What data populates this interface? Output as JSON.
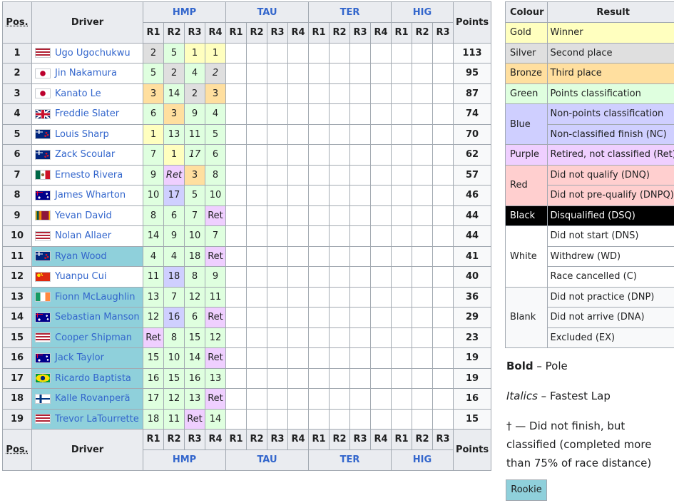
{
  "headers": {
    "pos": "Pos.",
    "driver": "Driver",
    "points": "Points"
  },
  "events": [
    {
      "name": "HMP",
      "rounds": [
        "R1",
        "R2",
        "R3",
        "R4"
      ]
    },
    {
      "name": "TAU",
      "rounds": [
        "R1",
        "R2",
        "R3",
        "R4"
      ]
    },
    {
      "name": "TER",
      "rounds": [
        "R1",
        "R2",
        "R3",
        "R4"
      ]
    },
    {
      "name": "HIG",
      "rounds": [
        "R1",
        "R2",
        "R3"
      ]
    }
  ],
  "rows": [
    {
      "pos": "1",
      "driver": "Ugo Ugochukwu",
      "flag": "us",
      "rookie": false,
      "points": "113",
      "results": [
        {
          "v": "2",
          "c": "silver",
          "b": true
        },
        {
          "v": "5",
          "c": "green"
        },
        {
          "v": "1",
          "c": "gold"
        },
        {
          "v": "1",
          "c": "gold",
          "b": true
        }
      ]
    },
    {
      "pos": "2",
      "driver": "Jin Nakamura",
      "flag": "jp",
      "rookie": false,
      "points": "95",
      "results": [
        {
          "v": "5",
          "c": "green"
        },
        {
          "v": "2",
          "c": "silver"
        },
        {
          "v": "4",
          "c": "green"
        },
        {
          "v": "2",
          "c": "silver",
          "i": true
        }
      ]
    },
    {
      "pos": "3",
      "driver": "Kanato Le",
      "flag": "jp",
      "rookie": false,
      "points": "87",
      "results": [
        {
          "v": "3",
          "c": "bronze"
        },
        {
          "v": "14",
          "c": "green"
        },
        {
          "v": "2",
          "c": "silver"
        },
        {
          "v": "3",
          "c": "bronze"
        }
      ]
    },
    {
      "pos": "4",
      "driver": "Freddie Slater",
      "flag": "gb",
      "rookie": false,
      "points": "74",
      "results": [
        {
          "v": "6",
          "c": "green"
        },
        {
          "v": "3",
          "c": "bronze"
        },
        {
          "v": "9",
          "c": "green"
        },
        {
          "v": "4",
          "c": "green"
        }
      ]
    },
    {
      "pos": "5",
      "driver": "Louis Sharp",
      "flag": "nz",
      "rookie": false,
      "points": "70",
      "results": [
        {
          "v": "1",
          "c": "gold"
        },
        {
          "v": "13",
          "c": "green"
        },
        {
          "v": "11",
          "c": "green"
        },
        {
          "v": "5",
          "c": "green"
        }
      ]
    },
    {
      "pos": "6",
      "driver": "Zack Scoular",
      "flag": "nz",
      "rookie": false,
      "points": "62",
      "results": [
        {
          "v": "7",
          "c": "green"
        },
        {
          "v": "1",
          "c": "gold"
        },
        {
          "v": "17",
          "c": "green",
          "i": true
        },
        {
          "v": "6",
          "c": "green"
        }
      ]
    },
    {
      "pos": "7",
      "driver": "Ernesto Rivera",
      "flag": "mx",
      "rookie": false,
      "points": "57",
      "results": [
        {
          "v": "9",
          "c": "green"
        },
        {
          "v": "Ret",
          "c": "purple",
          "i": true
        },
        {
          "v": "3",
          "c": "bronze"
        },
        {
          "v": "8",
          "c": "green"
        }
      ]
    },
    {
      "pos": "8",
      "driver": "James Wharton",
      "flag": "au",
      "rookie": false,
      "points": "46",
      "results": [
        {
          "v": "10",
          "c": "green"
        },
        {
          "v": "17",
          "c": "blue"
        },
        {
          "v": "5",
          "c": "green"
        },
        {
          "v": "10",
          "c": "green"
        }
      ]
    },
    {
      "pos": "9",
      "driver": "Yevan David",
      "flag": "lk",
      "rookie": false,
      "points": "44",
      "results": [
        {
          "v": "8",
          "c": "green"
        },
        {
          "v": "6",
          "c": "green"
        },
        {
          "v": "7",
          "c": "green"
        },
        {
          "v": "Ret",
          "c": "purple"
        }
      ]
    },
    {
      "pos": "10",
      "driver": "Nolan Allaer",
      "flag": "us",
      "rookie": false,
      "points": "44",
      "results": [
        {
          "v": "14",
          "c": "green"
        },
        {
          "v": "9",
          "c": "green"
        },
        {
          "v": "10",
          "c": "green"
        },
        {
          "v": "7",
          "c": "green"
        }
      ]
    },
    {
      "pos": "11",
      "driver": "Ryan Wood",
      "flag": "nz",
      "rookie": true,
      "points": "41",
      "results": [
        {
          "v": "4",
          "c": "green"
        },
        {
          "v": "4",
          "c": "green"
        },
        {
          "v": "18",
          "c": "green"
        },
        {
          "v": "Ret",
          "c": "purple"
        }
      ]
    },
    {
      "pos": "12",
      "driver": "Yuanpu Cui",
      "flag": "cn",
      "rookie": false,
      "points": "40",
      "results": [
        {
          "v": "11",
          "c": "green"
        },
        {
          "v": "18",
          "c": "blue"
        },
        {
          "v": "8",
          "c": "green"
        },
        {
          "v": "9",
          "c": "green"
        }
      ]
    },
    {
      "pos": "13",
      "driver": "Fionn McLaughlin",
      "flag": "ie",
      "rookie": true,
      "points": "36",
      "results": [
        {
          "v": "13",
          "c": "green"
        },
        {
          "v": "7",
          "c": "green"
        },
        {
          "v": "12",
          "c": "green"
        },
        {
          "v": "11",
          "c": "green"
        }
      ]
    },
    {
      "pos": "14",
      "driver": "Sebastian Manson",
      "flag": "au",
      "rookie": true,
      "points": "29",
      "results": [
        {
          "v": "12",
          "c": "green"
        },
        {
          "v": "16",
          "c": "blue"
        },
        {
          "v": "6",
          "c": "green"
        },
        {
          "v": "Ret",
          "c": "purple"
        }
      ]
    },
    {
      "pos": "15",
      "driver": "Cooper Shipman",
      "flag": "us",
      "rookie": true,
      "points": "23",
      "results": [
        {
          "v": "Ret",
          "c": "purple"
        },
        {
          "v": "8",
          "c": "green"
        },
        {
          "v": "15",
          "c": "green"
        },
        {
          "v": "12",
          "c": "green"
        }
      ]
    },
    {
      "pos": "16",
      "driver": "Jack Taylor",
      "flag": "au",
      "rookie": true,
      "points": "19",
      "results": [
        {
          "v": "15",
          "c": "green"
        },
        {
          "v": "10",
          "c": "green"
        },
        {
          "v": "14",
          "c": "green"
        },
        {
          "v": "Ret",
          "c": "purple"
        }
      ]
    },
    {
      "pos": "17",
      "driver": "Ricardo Baptista",
      "flag": "br",
      "rookie": true,
      "points": "19",
      "results": [
        {
          "v": "16",
          "c": "green"
        },
        {
          "v": "15",
          "c": "green"
        },
        {
          "v": "16",
          "c": "green"
        },
        {
          "v": "13",
          "c": "green"
        }
      ]
    },
    {
      "pos": "18",
      "driver": "Kalle Rovanperä",
      "flag": "fi",
      "rookie": true,
      "points": "16",
      "results": [
        {
          "v": "17",
          "c": "green"
        },
        {
          "v": "12",
          "c": "green"
        },
        {
          "v": "13",
          "c": "green"
        },
        {
          "v": "Ret",
          "c": "purple"
        }
      ]
    },
    {
      "pos": "19",
      "driver": "Trevor LaTourrette",
      "flag": "us",
      "rookie": true,
      "points": "15",
      "results": [
        {
          "v": "18",
          "c": "green"
        },
        {
          "v": "11",
          "c": "green"
        },
        {
          "v": "Ret",
          "c": "purple"
        },
        {
          "v": "14",
          "c": "green"
        }
      ]
    }
  ],
  "key": {
    "header_colour": "Colour",
    "header_result": "Result",
    "groups": [
      {
        "colour": "Gold",
        "cls": "gold",
        "results": [
          "Winner"
        ]
      },
      {
        "colour": "Silver",
        "cls": "silver",
        "results": [
          "Second place"
        ]
      },
      {
        "colour": "Bronze",
        "cls": "bronze",
        "results": [
          "Third place"
        ]
      },
      {
        "colour": "Green",
        "cls": "green",
        "results": [
          "Points classification"
        ]
      },
      {
        "colour": "Blue",
        "cls": "blue",
        "results": [
          "Non-points classification",
          "Non-classified finish (NC)"
        ]
      },
      {
        "colour": "Purple",
        "cls": "purple",
        "results": [
          "Retired, not classified (Ret)"
        ]
      },
      {
        "colour": "Red",
        "cls": "red",
        "results": [
          "Did not qualify (DNQ)",
          "Did not pre-qualify (DNPQ)"
        ]
      },
      {
        "colour": "Black",
        "cls": "black",
        "results": [
          "Disqualified (DSQ)"
        ]
      },
      {
        "colour": "White",
        "cls": "white",
        "results": [
          "Did not start (DNS)",
          "Withdrew (WD)",
          "Race cancelled (C)"
        ]
      },
      {
        "colour": "Blank",
        "cls": "blank",
        "results": [
          "Did not practice (DNP)",
          "Did not arrive (DNA)",
          "Excluded (EX)"
        ]
      }
    ]
  },
  "notes": {
    "bold_word": "Bold",
    "bold_desc": " – Pole",
    "italic_word": "Italics",
    "italic_desc": " – Fastest Lap",
    "dagger": "† — Did not finish, but classified (completed more than 75% of race distance)",
    "rookie": "Rookie"
  },
  "colors": {
    "gold": "#ffffbf",
    "silver": "#dfdfdf",
    "bronze": "#ffdf9f",
    "green": "#dfffdf",
    "blue": "#cfcfff",
    "purple": "#efcfff",
    "red": "#ffcfcf",
    "black": "#000000",
    "rookie": "#8fd0db",
    "link": "#3366cc"
  }
}
